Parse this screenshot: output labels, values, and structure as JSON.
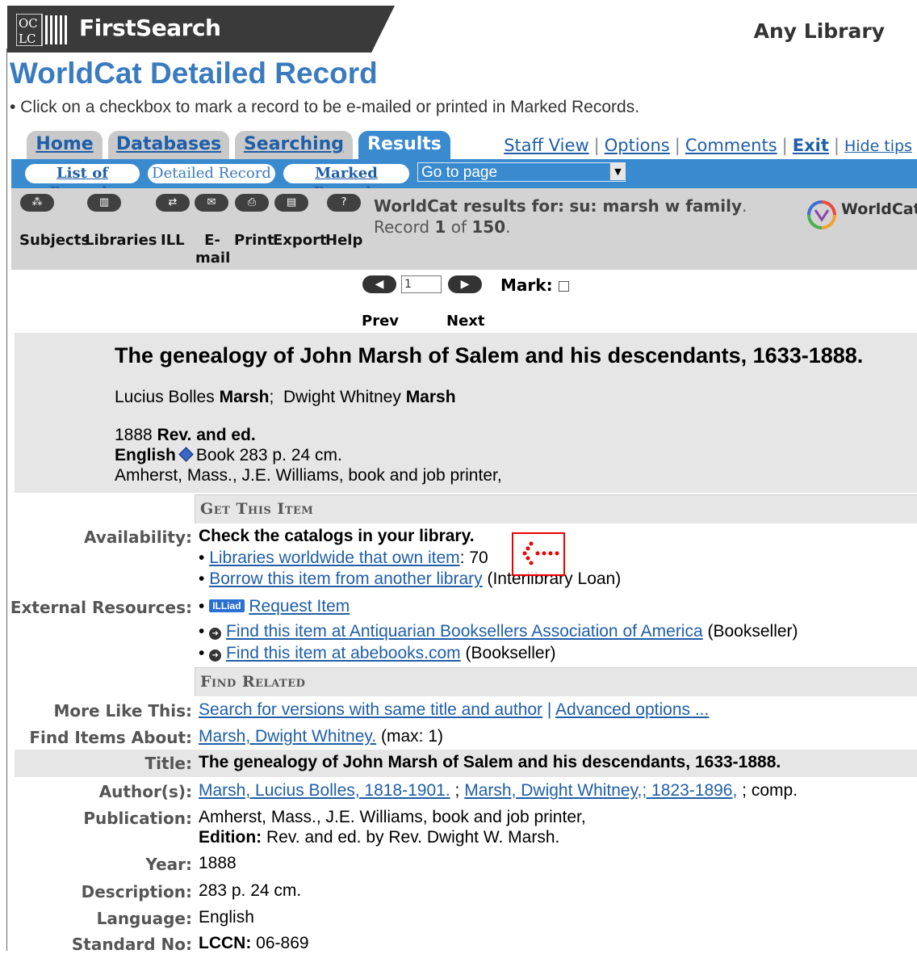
{
  "header": {
    "logo_text": "OCLC",
    "app_name": "FirstSearch",
    "library": "Any Library"
  },
  "page": {
    "title": "WorldCat Detailed Record",
    "tip": "• Click on a checkbox to mark a record to be e-mailed or printed in Marked Records."
  },
  "tabs": [
    "Home",
    "Databases",
    "Searching",
    "Results"
  ],
  "active_tab": "Results",
  "top_links": {
    "staff_view": "Staff View",
    "options": "Options",
    "comments": "Comments",
    "exit": "Exit",
    "hide_tips": "Hide tips"
  },
  "subnav": {
    "list": "List of Records",
    "detailed": "Detailed Record",
    "marked": "Marked Records",
    "goto": "Go to page"
  },
  "toolbar": {
    "subjects": "Subjects",
    "libraries": "Libraries",
    "ill": "ILL",
    "email": "E-mail",
    "print": "Print",
    "export": "Export",
    "help": "Help"
  },
  "results": {
    "prefix": "WorldCat results for:",
    "query": "su: marsh w family",
    "record_word": ". Record",
    "current": "1",
    "of_word": "of",
    "total": "150",
    "logo": "WorldCat"
  },
  "pager": {
    "page_value": "1",
    "mark_label": "Mark:",
    "prev": "Prev",
    "next": "Next"
  },
  "record": {
    "title": "The genealogy of John Marsh of Salem and his descendants, 1633-1888.",
    "author1_first": "Lucius Bolles",
    "author1_last": "Marsh",
    "author2_first": "Dwight Whitney",
    "author2_last": "Marsh",
    "year": "1888",
    "edition": "Rev. and ed.",
    "language": "English",
    "format": "Book",
    "physical": "283 p. 24 cm.",
    "publisher": "Amherst, Mass., J.E. Williams, book and job printer,"
  },
  "get_item": {
    "heading": "Get This Item",
    "availability_label": "Availability:",
    "availability_text": "Check the catalogs in your library.",
    "worldwide_link": "Libraries worldwide that own item",
    "worldwide_count": ": 70",
    "borrow_link": "Borrow this item from another library",
    "borrow_suffix": "(Interlibrary Loan)",
    "external_label": "External Resources:",
    "illiad_badge": "ILLiad",
    "request_link": "Request Item",
    "abaa_link": "Find this item at Antiquarian Booksellers Association of America",
    "abaa_suffix": "(Bookseller)",
    "abe_link": "Find this item at abebooks.com",
    "abe_suffix": "(Bookseller)"
  },
  "find_related": {
    "heading": "Find Related",
    "more_label": "More Like This:",
    "more_link": "Search for versions with same title and author",
    "sep": "|",
    "adv_link": "Advanced options ...",
    "about_label": "Find Items About:",
    "about_link": "Marsh, Dwight Whitney.",
    "about_suffix": "(max: 1)"
  },
  "details": {
    "title_label": "Title:",
    "title_value": "The genealogy of John Marsh of Salem and his descendants, 1633-1888.",
    "authors_label": "Author(s):",
    "author1": "Marsh, Lucius Bolles, 1818-1901.",
    "author_sep": ";",
    "author2": "Marsh, Dwight Whitney,; 1823-1896,",
    "author_suffix": "; comp.",
    "publication_label": "Publication:",
    "publication_value": "Amherst, Mass., J.E. Williams, book and job printer,",
    "edition_label": "Edition:",
    "edition_value": "Rev. and ed. by Rev. Dwight W. Marsh.",
    "year_label": "Year:",
    "year_value": "1888",
    "description_label": "Description:",
    "description_value": "283 p. 24 cm.",
    "language_label": "Language:",
    "language_value": "English",
    "standard_label": "Standard No:",
    "lccn_label": "LCCN:",
    "lccn_value": "06-869"
  },
  "colors": {
    "brand_blue": "#3a7bc0",
    "link": "#1f5ea8",
    "active_tab": "#3a8ad0",
    "header_dark": "#3a3a3a",
    "panel_gray": "#e6e6e6"
  }
}
